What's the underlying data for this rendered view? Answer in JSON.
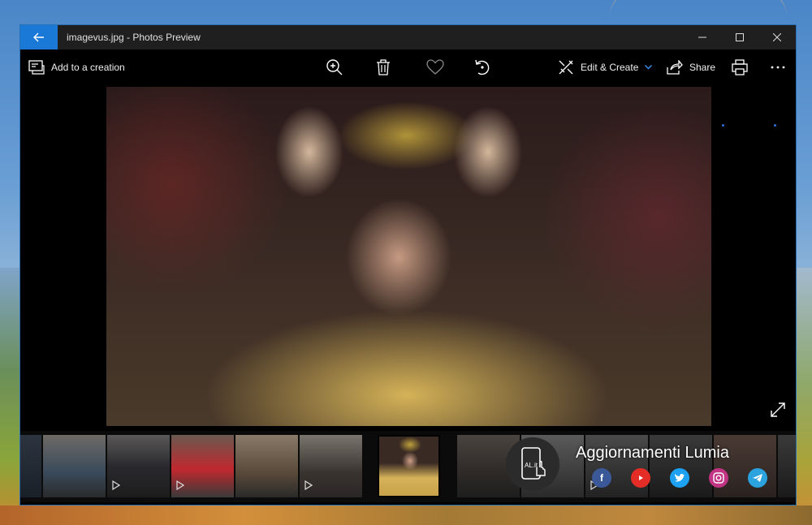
{
  "window": {
    "title": "imagevus.jpg - Photos Preview"
  },
  "toolbar": {
    "add_to_creation": "Add to a creation",
    "edit_create": "Edit & Create",
    "share": "Share"
  },
  "filmstrip": {
    "brand_title": "Aggiornamenti Lumia",
    "brand_logo_text": "AL.it"
  },
  "colors": {
    "accent": "#1a78d6",
    "facebook": "#3b5998",
    "youtube": "#e52d27",
    "twitter": "#1da1f2",
    "instagram": "#c13584",
    "telegram": "#2aa3df"
  }
}
